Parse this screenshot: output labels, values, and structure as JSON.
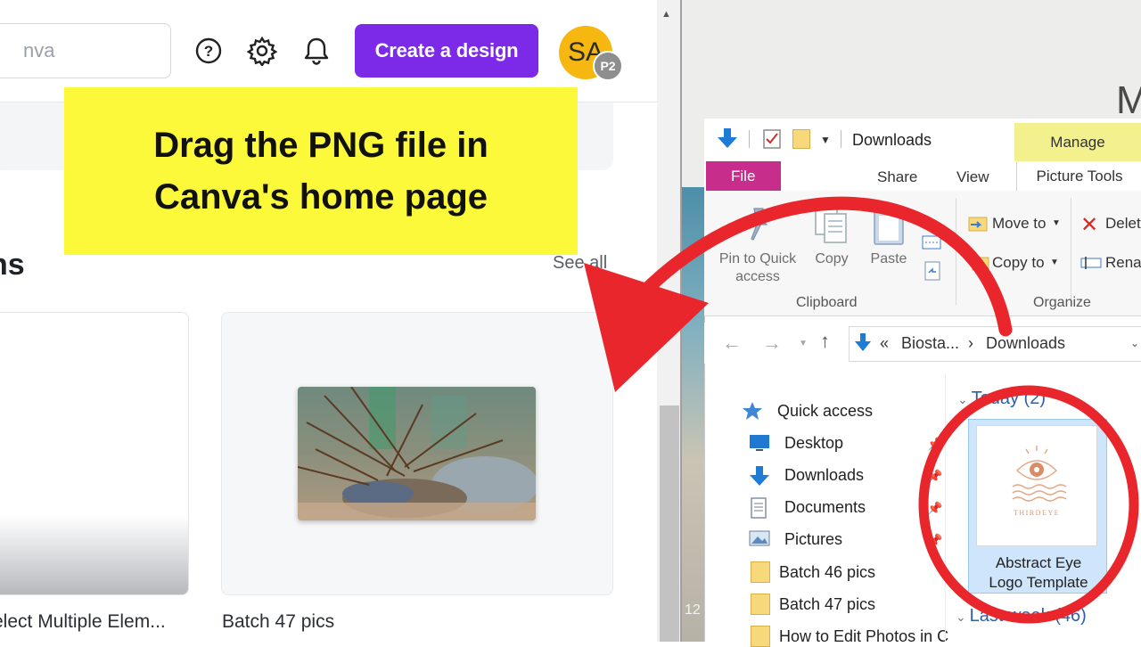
{
  "canva": {
    "search_placeholder": "nva",
    "create_button": "Create a design",
    "avatar_initials": "SA",
    "avatar_badge": "P2",
    "section_title": "ns",
    "see_all": "See all",
    "cards": [
      {
        "caption": "elect Multiple Elem..."
      },
      {
        "caption": "Batch 47 pics"
      }
    ]
  },
  "callout": {
    "line1": "Drag the PNG file in",
    "line2": "Canva's home page",
    "color": "#fbf93a"
  },
  "explorer": {
    "title": "Downloads",
    "context_tab": "Manage",
    "context_tab_color": "#f3f08e",
    "tabs": {
      "file": "File",
      "share": "Share",
      "view": "View",
      "picture_tools": "Picture Tools"
    },
    "ribbon": {
      "pin_line1": "Pin to Quick",
      "pin_line2": "access",
      "copy": "Copy",
      "paste": "Paste",
      "clipboard_group": "Clipboard",
      "move_to": "Move to",
      "copy_to": "Copy to",
      "delete": "Delet",
      "rename": "Rena",
      "organize_group": "Organize"
    },
    "address": {
      "prefix": "«",
      "crumb1": "Biosta...",
      "sep": "›",
      "crumb2": "Downloads"
    },
    "nav_pane": [
      {
        "label": "Quick access",
        "icon": "star-icon"
      },
      {
        "label": "Desktop",
        "icon": "desktop-icon"
      },
      {
        "label": "Downloads",
        "icon": "download-arrow-icon"
      },
      {
        "label": "Documents",
        "icon": "documents-icon"
      },
      {
        "label": "Pictures",
        "icon": "pictures-icon"
      },
      {
        "label": "Batch 46 pics",
        "icon": "folder-icon"
      },
      {
        "label": "Batch 47 pics",
        "icon": "folder-icon"
      },
      {
        "label": "How to Edit Photos in C",
        "icon": "folder-icon"
      }
    ],
    "groups": {
      "today": "Today (2)",
      "last_week": "Last week (46)"
    },
    "file": {
      "name_line1": "Abstract Eye",
      "name_line2": "Logo Template",
      "logo_text": "THIRDEYE"
    }
  },
  "desktop": {
    "letter": "M",
    "number": "12"
  },
  "annotation_color": "#e8262c"
}
